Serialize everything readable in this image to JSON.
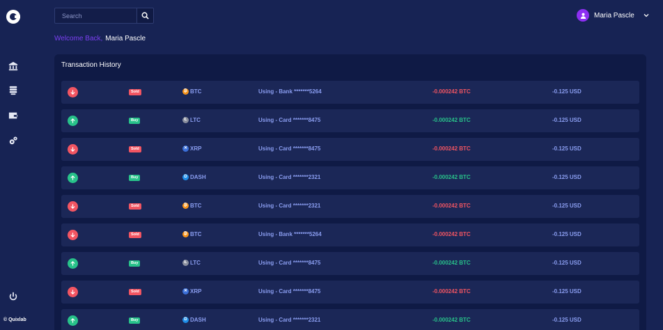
{
  "sidebar": {
    "logo": "logo-icon",
    "items": [
      {
        "icon": "bank-icon"
      },
      {
        "icon": "list-icon"
      },
      {
        "icon": "wallet-icon"
      },
      {
        "icon": "settings-icon"
      }
    ],
    "power_icon": "power-icon",
    "copyright": "© Quixlab"
  },
  "header": {
    "search": {
      "placeholder": "Search"
    },
    "welcome_prefix": "Welcome Back,",
    "welcome_name": "Maria Pascle",
    "user_name": "Maria Pascle"
  },
  "panel": {
    "title": "Transaction History",
    "rows": [
      {
        "direction": "down",
        "type": "Sold",
        "coin": "BTC",
        "method": "Using - Bank *******5264",
        "amount": "-0.000242 BTC",
        "usd": "-0.125 USD"
      },
      {
        "direction": "up",
        "type": "Buy",
        "coin": "LTC",
        "method": "Using - Card *******8475",
        "amount": "-0.000242 BTC",
        "usd": "-0.125 USD"
      },
      {
        "direction": "down",
        "type": "Sold",
        "coin": "XRP",
        "method": "Using - Card *******8475",
        "amount": "-0.000242 BTC",
        "usd": "-0.125 USD"
      },
      {
        "direction": "up",
        "type": "Buy",
        "coin": "DASH",
        "method": "Using - Card *******2321",
        "amount": "-0.000242 BTC",
        "usd": "-0.125 USD"
      },
      {
        "direction": "down",
        "type": "Sold",
        "coin": "BTC",
        "method": "Using - Card *******2321",
        "amount": "-0.000242 BTC",
        "usd": "-0.125 USD"
      },
      {
        "direction": "down",
        "type": "Sold",
        "coin": "BTC",
        "method": "Using - Bank *******5264",
        "amount": "-0.000242 BTC",
        "usd": "-0.125 USD"
      },
      {
        "direction": "up",
        "type": "Buy",
        "coin": "LTC",
        "method": "Using - Card *******8475",
        "amount": "-0.000242 BTC",
        "usd": "-0.125 USD"
      },
      {
        "direction": "down",
        "type": "Sold",
        "coin": "XRP",
        "method": "Using - Card *******8475",
        "amount": "-0.000242 BTC",
        "usd": "-0.125 USD"
      },
      {
        "direction": "up",
        "type": "Buy",
        "coin": "DASH",
        "method": "Using - Card *******2321",
        "amount": "-0.000242 BTC",
        "usd": "-0.125 USD"
      }
    ]
  },
  "colors": {
    "sold": "#f25562",
    "buy": "#28c28a",
    "btc": "#f7931a",
    "ltc": "#8a8f9e",
    "xrp": "#3b6fd8",
    "dash": "#1f8de8"
  }
}
